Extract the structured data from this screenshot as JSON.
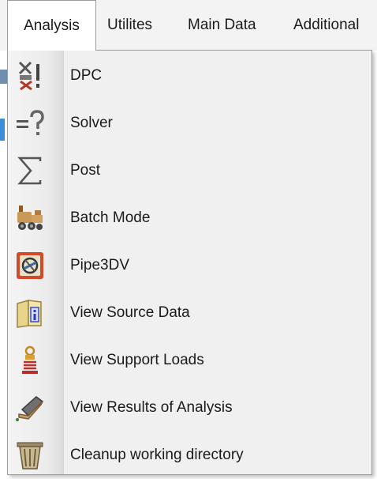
{
  "menubar": {
    "items": [
      {
        "label": "Analysis",
        "active": true
      },
      {
        "label": "Utilites"
      },
      {
        "label": "Main Data"
      },
      {
        "label": "Additional"
      }
    ]
  },
  "menu": {
    "items": [
      {
        "label": "DPC",
        "icon": "dpc-icon"
      },
      {
        "label": "Solver",
        "icon": "solver-icon"
      },
      {
        "label": "Post",
        "icon": "sigma-icon"
      },
      {
        "label": "Batch Mode",
        "icon": "locomotive-icon"
      },
      {
        "label": "Pipe3DV",
        "icon": "pipe3dv-icon"
      },
      {
        "label": "View Source Data",
        "icon": "book-info-icon"
      },
      {
        "label": "View Support Loads",
        "icon": "support-spring-icon"
      },
      {
        "label": "View Results of Analysis",
        "icon": "results-book-icon"
      },
      {
        "label": "Cleanup working directory",
        "icon": "trash-bin-icon"
      }
    ]
  },
  "colors": {
    "menu_bg": "#f0f0f0",
    "menubar_bg": "#f3f3f3",
    "border": "#9c9c9c",
    "text": "#1a1a1a"
  }
}
